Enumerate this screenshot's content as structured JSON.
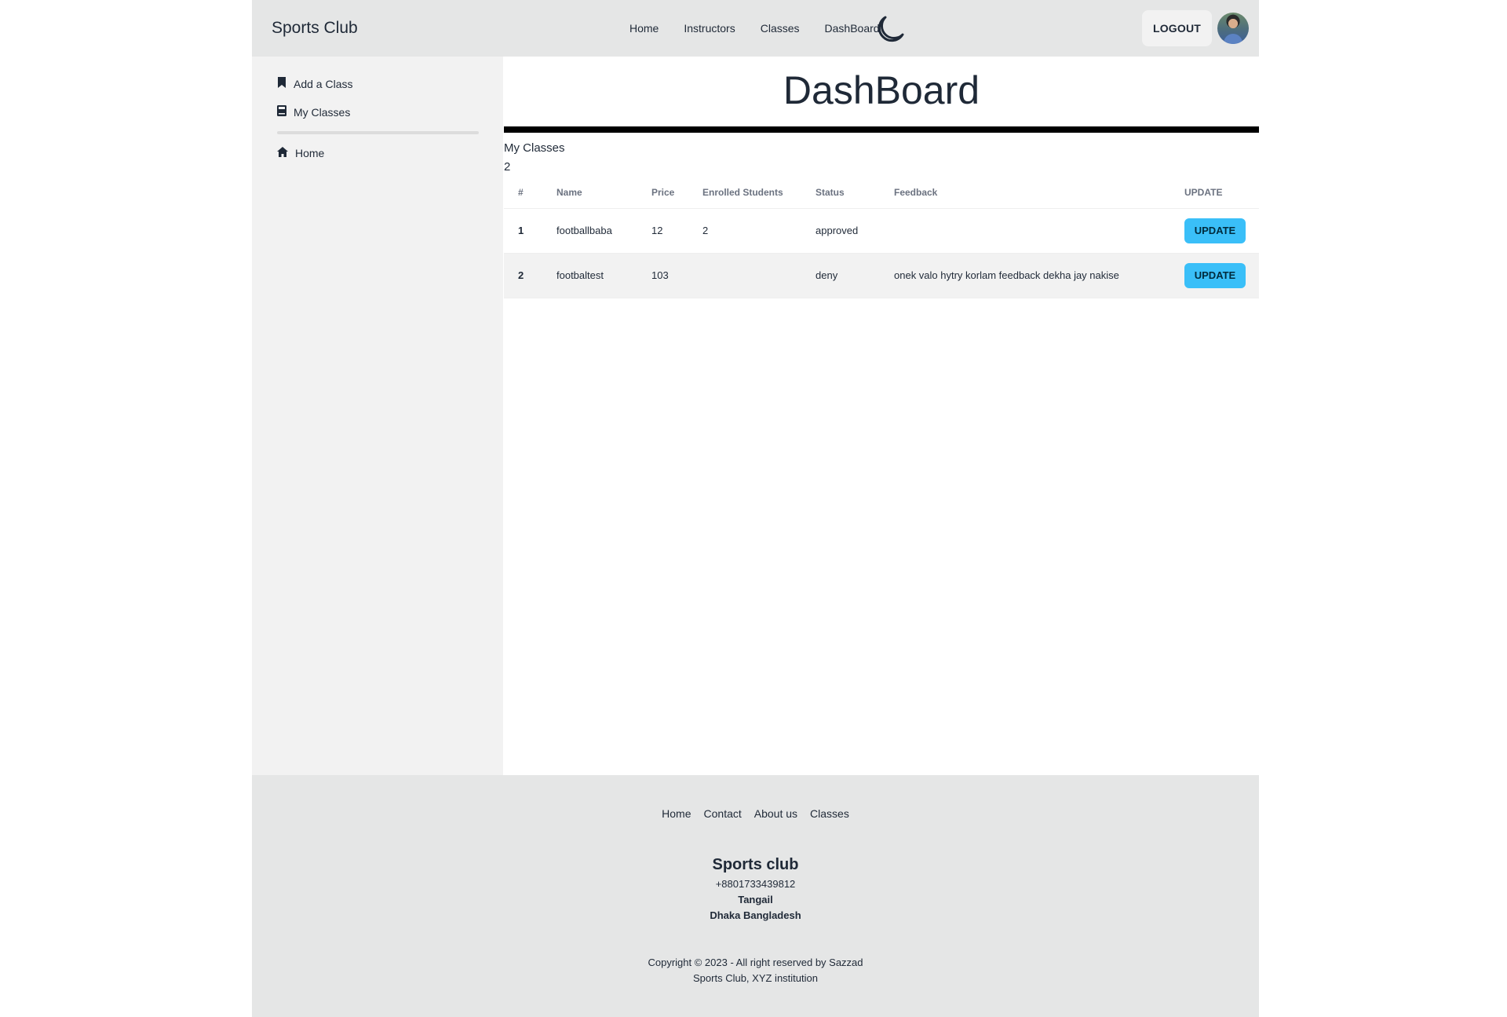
{
  "navbar": {
    "brand": "Sports Club",
    "links": [
      "Home",
      "Instructors",
      "Classes",
      "DashBoard"
    ],
    "theme_toggle_icon": "moon-icon",
    "logout_label": "LOGOUT",
    "avatar_icon": "user-avatar"
  },
  "sidebar": {
    "items": [
      {
        "label": "Add a Class",
        "icon": "bookmark-icon"
      },
      {
        "label": "My Classes",
        "icon": "book-icon"
      },
      {
        "label": "Home",
        "icon": "home-icon"
      }
    ]
  },
  "main": {
    "title": "DashBoard",
    "section_label": "My Classes",
    "class_count": "2",
    "table": {
      "headers": [
        "#",
        "Name",
        "Price",
        "Enrolled Students",
        "Status",
        "Feedback",
        "UPDATE"
      ],
      "rows": [
        {
          "num": "1",
          "name": "footballbaba",
          "price": "12",
          "enrolled": "2",
          "status": "approved",
          "feedback": "",
          "action": "UPDATE"
        },
        {
          "num": "2",
          "name": "footbaltest",
          "price": "103",
          "enrolled": "",
          "status": "deny",
          "feedback": "onek valo hytry korlam feedback dekha jay nakise",
          "action": "UPDATE"
        }
      ]
    }
  },
  "footer": {
    "links": [
      "Home",
      "Contact",
      "About us",
      "Classes"
    ],
    "org_name": "Sports club",
    "phone": "+8801733439812",
    "city": "Tangail",
    "country": "Dhaka Bangladesh",
    "copyright": "Copyright © 2023 - All right reserved by Sazzad",
    "institution": "Sports Club, XYZ institution"
  },
  "colors": {
    "navbar_bg": "#e5e6e6",
    "sidebar_bg": "#f2f2f2",
    "update_button": "#3abff8",
    "rule": "#000000"
  }
}
